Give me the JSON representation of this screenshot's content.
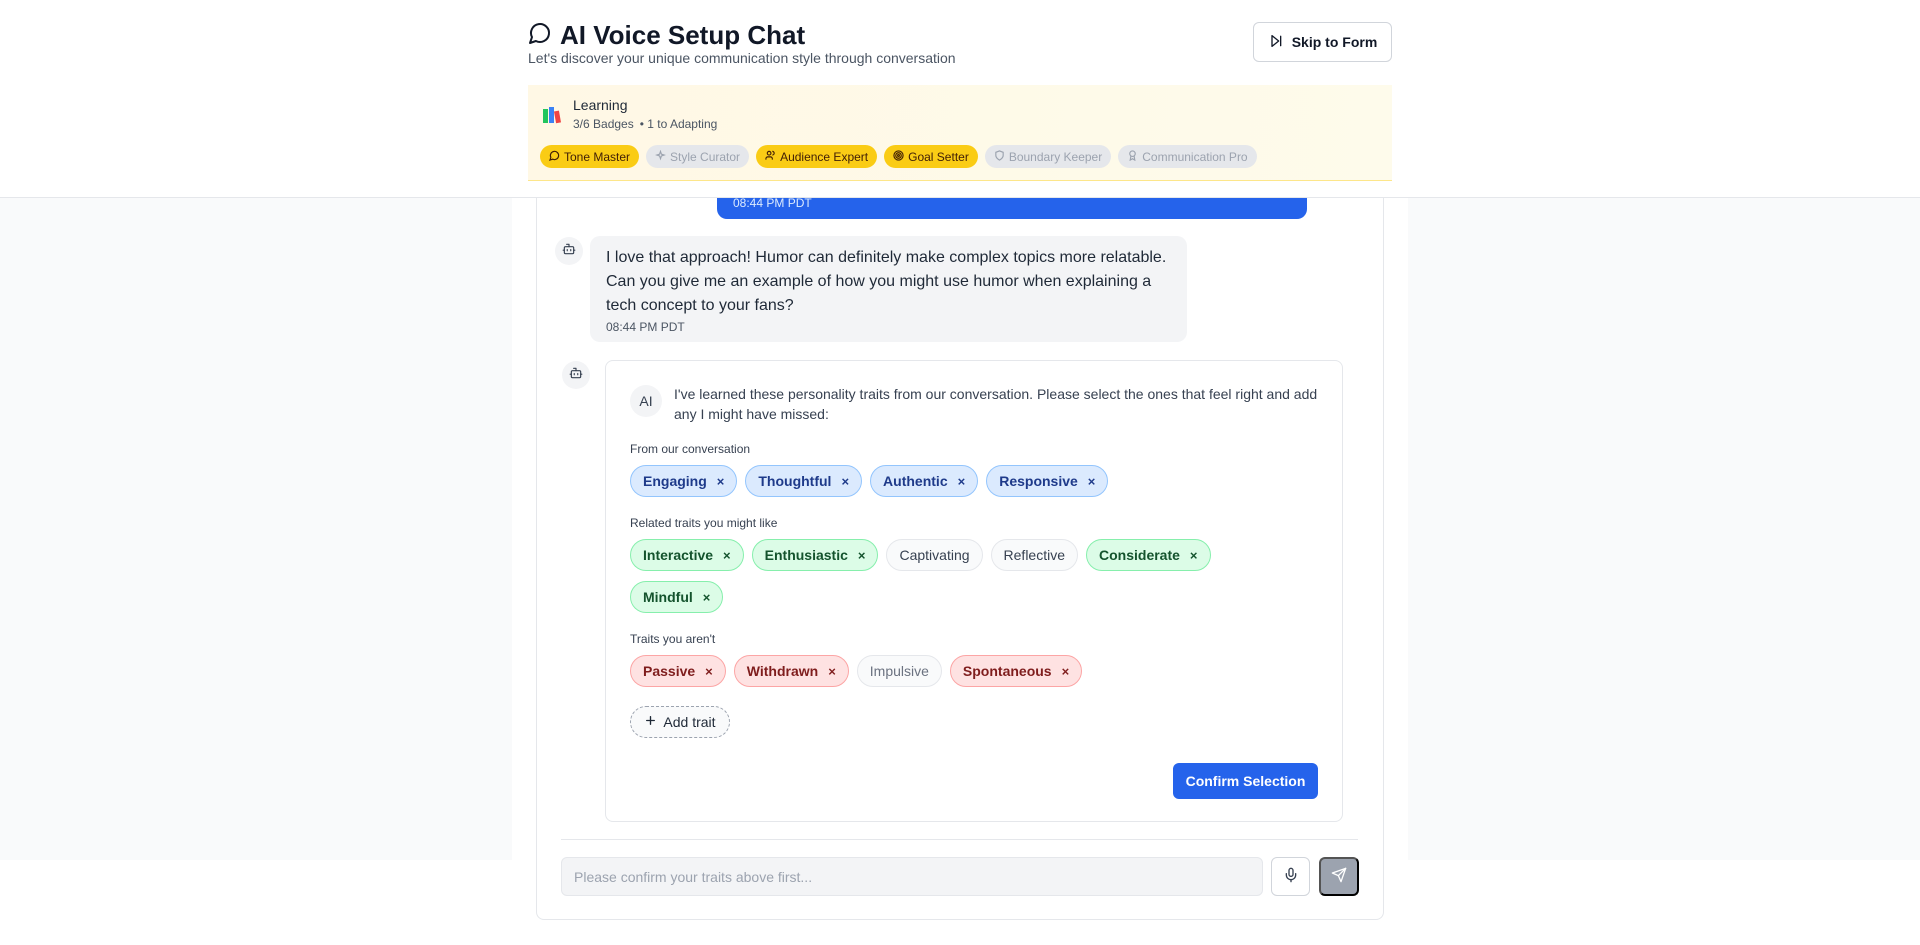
{
  "header": {
    "title": "AI Voice Setup Chat",
    "subtitle": "Let's discover your unique communication style through conversation",
    "skip_label": "Skip to Form"
  },
  "progress": {
    "level_name": "Learning",
    "badges_count": "3/6 Badges",
    "next_level": "• 1 to Adapting",
    "badges": [
      {
        "label": "Tone Master",
        "earned": true,
        "icon": "chat-icon"
      },
      {
        "label": "Style Curator",
        "earned": false,
        "icon": "sparkles-icon"
      },
      {
        "label": "Audience Expert",
        "earned": true,
        "icon": "users-icon"
      },
      {
        "label": "Goal Setter",
        "earned": true,
        "icon": "target-icon"
      },
      {
        "label": "Boundary Keeper",
        "earned": false,
        "icon": "shield-icon"
      },
      {
        "label": "Communication Pro",
        "earned": false,
        "icon": "award-icon"
      }
    ]
  },
  "messages": {
    "user_tail_time": "08:44 PM PDT",
    "ai_message": {
      "text": "I love that approach! Humor can definitely make complex topics more relatable. Can you give me an example of how you might use humor when explaining a tech concept to your fans?",
      "time": "08:44 PM PDT"
    }
  },
  "traits": {
    "ai_chip": "AI",
    "intro": "I've learned these personality traits from our conversation. Please select the ones that feel right and add any I might have missed:",
    "sections": {
      "conversation_label": "From our conversation",
      "related_label": "Related traits you might like",
      "not_label": "Traits you aren't"
    },
    "from_conversation": [
      "Engaging",
      "Thoughtful",
      "Authentic",
      "Responsive"
    ],
    "related_row1": [
      {
        "label": "Interactive",
        "selected": true
      },
      {
        "label": "Enthusiastic",
        "selected": true
      },
      {
        "label": "Captivating",
        "selected": false
      },
      {
        "label": "Reflective",
        "selected": false
      },
      {
        "label": "Considerate",
        "selected": true
      }
    ],
    "related_row2": [
      {
        "label": "Mindful",
        "selected": true
      }
    ],
    "not_traits": [
      {
        "label": "Passive",
        "selected": true
      },
      {
        "label": "Withdrawn",
        "selected": true
      },
      {
        "label": "Impulsive",
        "selected": false
      },
      {
        "label": "Spontaneous",
        "selected": true
      }
    ],
    "add_label": "Add trait",
    "confirm_label": "Confirm Selection",
    "remove_glyph": "×"
  },
  "composer": {
    "placeholder": "Please confirm your traits above first..."
  },
  "colors": {
    "accent": "#2563eb",
    "badge_earned": "#facc15",
    "badge_locked": "#e5e7eb"
  }
}
